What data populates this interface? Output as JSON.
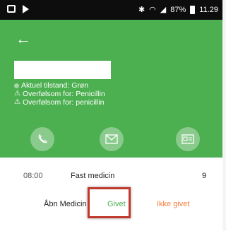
{
  "status_bar": {
    "battery": "87%",
    "time": "11.29",
    "icons": [
      "gallery-icon",
      "play-icon",
      "bluetooth-icon",
      "wifi-icon",
      "signal-icon",
      "battery-icon"
    ]
  },
  "header": {
    "back_icon": "arrow-left-icon",
    "patient_name": "",
    "condition": "Aktuel tilstand: Grøn",
    "allergies": [
      "Overfølsom for: Penicillin",
      "Overfølsom for: penicillin"
    ],
    "actions": [
      "phone-icon",
      "mail-icon",
      "id-card-icon"
    ],
    "bg_color": "#4caf50"
  },
  "medication": {
    "time": "08:00",
    "title": "Fast medicin",
    "count": "9",
    "open_label": "Åbn Medicin",
    "given_label": "Givet",
    "not_given_label": "Ikke givet",
    "given_color": "#4caf50",
    "not_given_color": "#f57c3c"
  }
}
